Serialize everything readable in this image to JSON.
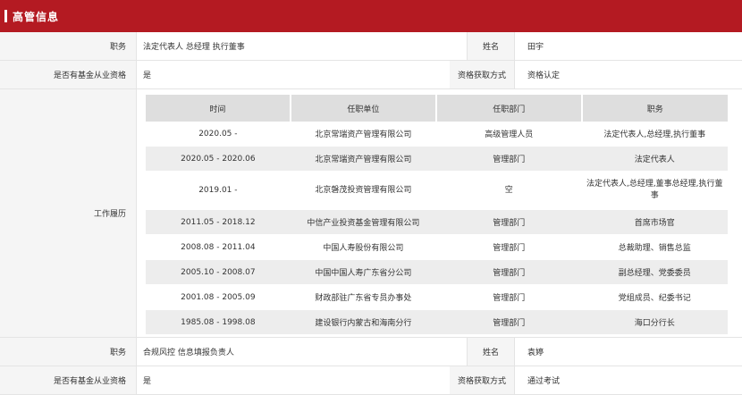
{
  "header": {
    "title": "高管信息"
  },
  "person1": {
    "position_label": "职务",
    "position_value": "法定代表人 总经理 执行董事",
    "name_label": "姓名",
    "name_value": "田宇",
    "fund_label": "是否有基金从业资格",
    "fund_value": "是",
    "qual_label": "资格获取方式",
    "qual_value": "资格认定"
  },
  "history": {
    "label": "工作履历",
    "columns": [
      "时间",
      "任职单位",
      "任职部门",
      "职务"
    ],
    "rows": [
      [
        "2020.05 -",
        "北京常瑞资产管理有限公司",
        "高级管理人员",
        "法定代表人,总经理,执行董事"
      ],
      [
        "2020.05 - 2020.06",
        "北京常瑞资产管理有限公司",
        "管理部门",
        "法定代表人"
      ],
      [
        "2019.01 -",
        "北京磐茂投资管理有限公司",
        "空",
        "法定代表人,总经理,董事总经理,执行董事"
      ],
      [
        "2011.05 - 2018.12",
        "中信产业投资基金管理有限公司",
        "管理部门",
        "首席市场官"
      ],
      [
        "2008.08 - 2011.04",
        "中国人寿股份有限公司",
        "管理部门",
        "总裁助理、销售总监"
      ],
      [
        "2005.10 - 2008.07",
        "中国中国人寿广东省分公司",
        "管理部门",
        "副总经理、党委委员"
      ],
      [
        "2001.08 - 2005.09",
        "财政部驻广东省专员办事处",
        "管理部门",
        "党组成员、纪委书记"
      ],
      [
        "1985.08 - 1998.08",
        "建设银行内蒙古和海南分行",
        "管理部门",
        "海口分行长"
      ]
    ]
  },
  "person2": {
    "position_label": "职务",
    "position_value": "合规风控 信息填报负责人",
    "name_label": "姓名",
    "name_value": "袁婷",
    "fund_label": "是否有基金从业资格",
    "fund_value": "是",
    "qual_label": "资格获取方式",
    "qual_value": "通过考试"
  }
}
